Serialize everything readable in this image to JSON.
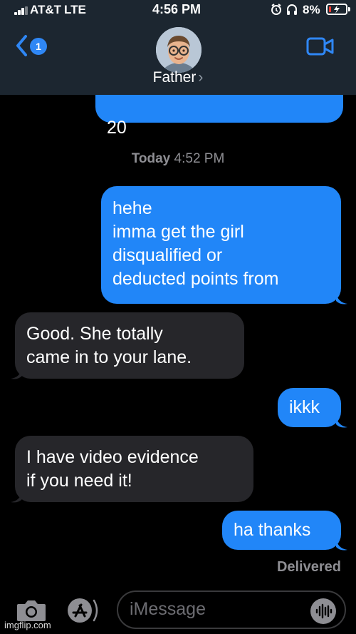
{
  "status_bar": {
    "carrier": "AT&T",
    "network": "LTE",
    "time": "4:56 PM",
    "battery_percent": "8%",
    "icons": [
      "signal-icon",
      "alarm-icon",
      "headphones-icon",
      "battery-charging-icon"
    ]
  },
  "header": {
    "back_badge_count": "1",
    "contact_name": "Father",
    "chevron": "›",
    "icons": [
      "back-chevron-icon",
      "video-call-icon",
      "memoji-avatar-icon"
    ]
  },
  "conversation": {
    "partial_message": "20",
    "timestamp_day": "Today",
    "timestamp_time": "4:52 PM",
    "messages": [
      {
        "direction": "outgoing",
        "text": "hehe\nimma get the girl\ndisqualified or\ndeducted  points from"
      },
      {
        "direction": "incoming",
        "text": "Good. She totally\ncame in to your lane."
      },
      {
        "direction": "outgoing",
        "text": "ikkk"
      },
      {
        "direction": "incoming",
        "text": "I have video evidence\nif you need it!"
      },
      {
        "direction": "outgoing",
        "text": "ha thanks"
      }
    ],
    "delivered_label": "Delivered"
  },
  "input_bar": {
    "placeholder": "iMessage",
    "icons": [
      "camera-icon",
      "app-store-icon",
      "audio-waveform-icon"
    ]
  },
  "watermark": "imgflip.com",
  "colors": {
    "header_bg": "#1c2630",
    "outgoing_bubble": "#2186f8",
    "incoming_bubble": "#26262a",
    "accent": "#2f87f5",
    "background": "#000000"
  }
}
